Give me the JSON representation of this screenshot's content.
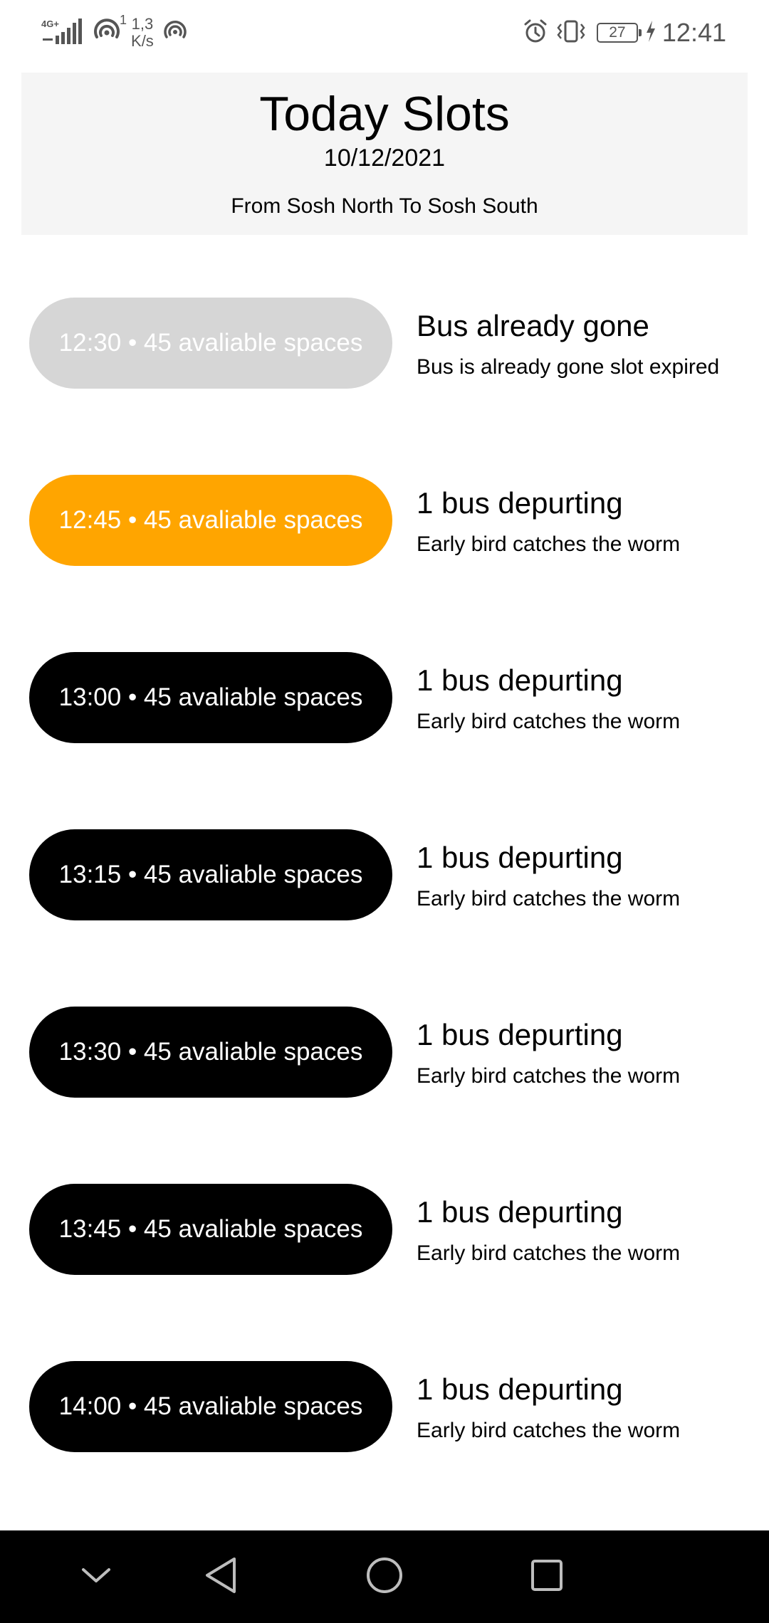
{
  "status_bar": {
    "network_type": "4G+",
    "wifi_badge": "1",
    "speed_value": "1,3",
    "speed_unit": "K/s",
    "battery_level": "27",
    "time": "12:41",
    "icons": [
      "signal-icon",
      "wifi-icon",
      "hotspot-icon",
      "alarm-icon",
      "vibrate-icon",
      "battery-icon",
      "charging-icon"
    ]
  },
  "header": {
    "title": "Today Slots",
    "date": "10/12/2021",
    "route": "From Sosh North To Sosh South"
  },
  "slots": [
    {
      "label": "12:30 • 45 avaliable spaces",
      "state": "expired",
      "title": "Bus already gone",
      "subtitle": "Bus is already gone slot expired"
    },
    {
      "label": "12:45 • 45 avaliable spaces",
      "state": "active",
      "title": "1 bus depurting",
      "subtitle": "Early bird catches the worm"
    },
    {
      "label": "13:00 • 45 avaliable spaces",
      "state": "available",
      "title": "1 bus depurting",
      "subtitle": "Early bird catches the worm"
    },
    {
      "label": "13:15 • 45 avaliable spaces",
      "state": "available",
      "title": "1 bus depurting",
      "subtitle": "Early bird catches the worm"
    },
    {
      "label": "13:30 • 45 avaliable spaces",
      "state": "available",
      "title": "1 bus depurting",
      "subtitle": "Early bird catches the worm"
    },
    {
      "label": "13:45 • 45 avaliable spaces",
      "state": "available",
      "title": "1 bus depurting",
      "subtitle": "Early bird catches the worm"
    },
    {
      "label": "14:00 • 45 avaliable spaces",
      "state": "available",
      "title": "1 bus depurting",
      "subtitle": "Early bird catches the worm"
    }
  ],
  "colors": {
    "expired": "#d6d6d6",
    "active": "#ffa500",
    "available": "#000000",
    "header_bg": "#f5f5f5",
    "nav_bg": "#000000"
  },
  "nav_bar": {
    "buttons": [
      "chevron-down-icon",
      "back-icon",
      "home-icon",
      "recents-icon"
    ]
  }
}
